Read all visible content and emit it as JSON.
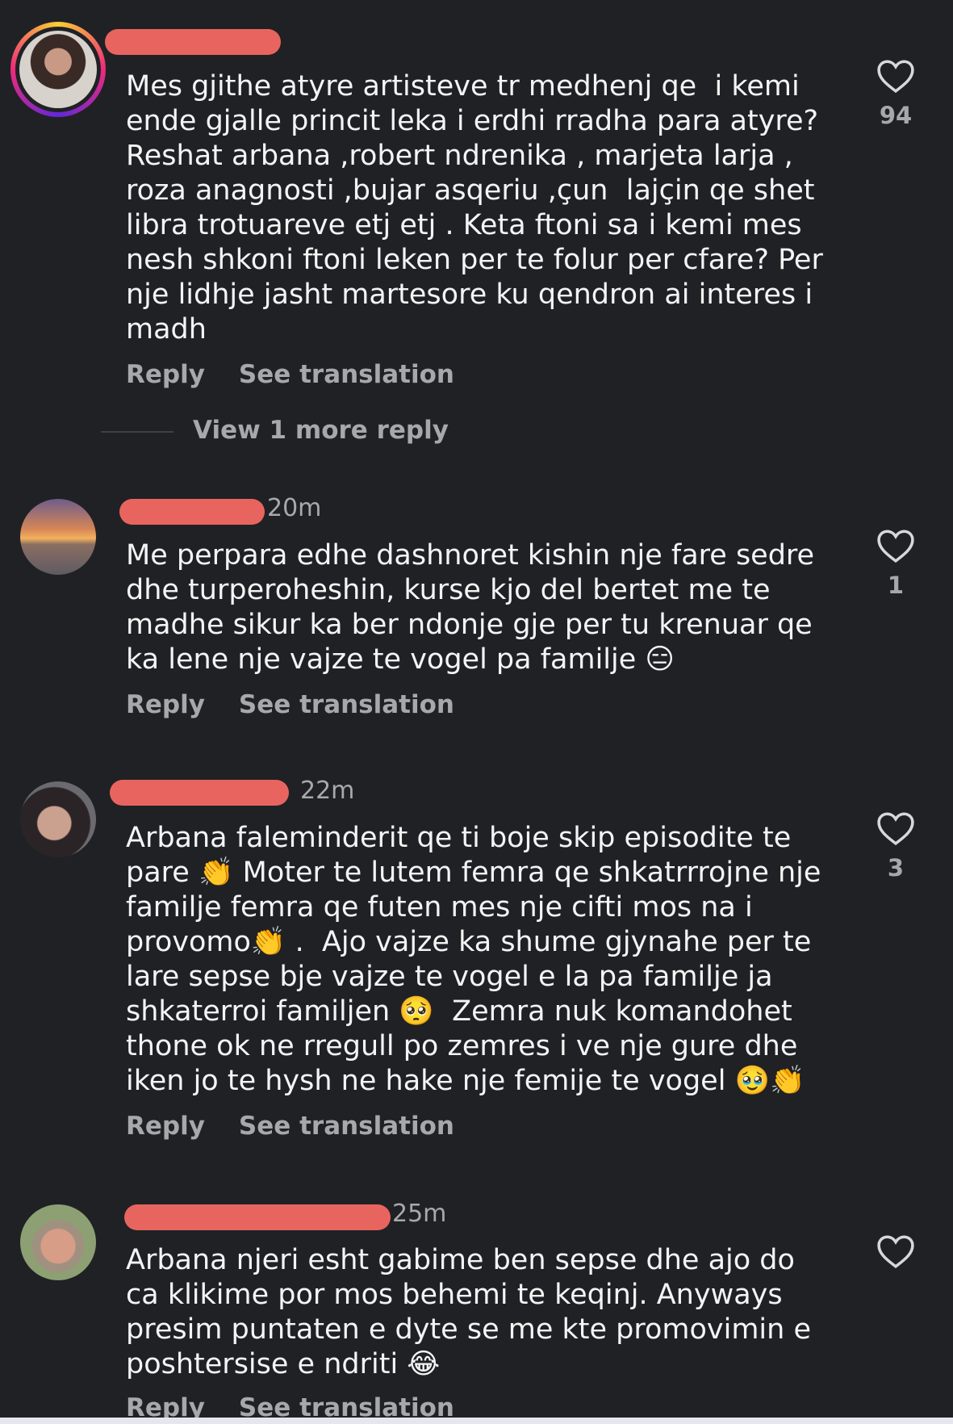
{
  "comments": [
    {
      "time": "",
      "text": "Mes gjithe atyre artisteve tr medhenj qe  i kemi ende gjalle princit leka i erdhi rradha para atyre? Reshat arbana ,robert ndrenika , marjeta larja , roza anagnosti ,bujar asqeriu ,çun  lajçin qe shet libra trotuareve etj etj . Keta ftoni sa i kemi mes nesh shkoni ftoni leken per te folur per cfare? Per nje lidhje jasht martesore ku qendron ai interes i madh",
      "reply": "Reply",
      "see_translation": "See translation",
      "likes": "94",
      "view_more": "View 1 more reply"
    },
    {
      "time": "20m",
      "text": "Me perpara edhe dashnoret kishin nje fare sedre dhe turperoheshin, kurse kjo del bertet me te madhe sikur ka ber ndonje gje per tu krenuar qe ka lene nje vajze te vogel pa familje 😑",
      "reply": "Reply",
      "see_translation": "See translation",
      "likes": "1"
    },
    {
      "time": "22m",
      "text": "Arbana faleminderit qe ti boje skip episodite te pare 👏 Moter te lutem femra qe shkatrrrojne nje familje femra qe futen mes nje cifti mos na i provomo👏 .  Ajo vajze ka shume gjynahe per te lare sepse bje vajze te vogel e la pa familje ja shkaterroi familjen 🥺  Zemra nuk komandohet thone ok ne rregull po zemres i ve nje gure dhe iken jo te hysh ne hake nje femije te vogel 🥹👏",
      "reply": "Reply",
      "see_translation": "See translation",
      "likes": "3"
    },
    {
      "time": "25m",
      "text": "Arbana njeri esht gabime ben sepse dhe ajo do ca klikime por mos behemi te keqinj. Anyways presim puntaten e dyte se me kte promovimin e poshtersise e ndriti 😂",
      "reply": "Reply",
      "see_translation": "See translation",
      "likes": ""
    }
  ],
  "icons": {
    "like": "heart-outline-icon"
  },
  "colors": {
    "background": "#202125",
    "muted": "#a5a8ad",
    "redaction": "#e8655f"
  }
}
